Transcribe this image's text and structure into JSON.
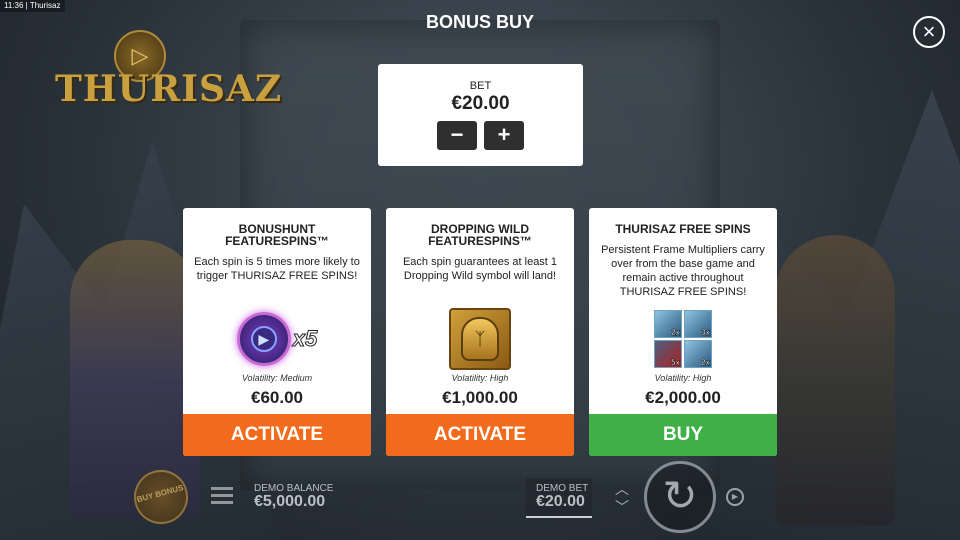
{
  "status_bar": {
    "time": "11:36",
    "app": "Thurisaz"
  },
  "logo": {
    "text": "THURISAZ"
  },
  "header": {
    "title": "BONUS BUY"
  },
  "bet": {
    "label": "BET",
    "value": "€20.00",
    "minus": "−",
    "plus": "+"
  },
  "cards": [
    {
      "title": "BONUSHUNT FEATURESPINS™",
      "description": "Each spin is 5 times more likely to trigger THURISAZ FREE SPINS!",
      "multiplier": "x5",
      "volatility": "Volatility: Medium",
      "price": "€60.00",
      "action": "ACTIVATE",
      "action_color": "#f26a1b"
    },
    {
      "title": "DROPPING WILD FEATURESPINS™",
      "description": "Each spin guarantees at least 1 Dropping Wild symbol will land!",
      "volatility": "Volatility: High",
      "price": "€1,000.00",
      "action": "ACTIVATE",
      "action_color": "#f26a1b"
    },
    {
      "title": "THURISAZ FREE SPINS",
      "description": "Persistent Frame Multipliers carry over from the base game and remain active throughout THURISAZ FREE SPINS!",
      "multipliers": [
        "2x",
        "3x",
        "5x",
        "2x"
      ],
      "volatility": "Volatility: High",
      "price": "€2,000.00",
      "action": "BUY",
      "action_color": "#3fb045"
    }
  ],
  "hud": {
    "buy_bonus": "BUY BONUS",
    "balance_label": "DEMO BALANCE",
    "balance_value": "€5,000.00",
    "bet_label": "DEMO BET",
    "bet_value": "€20.00"
  },
  "icons": {
    "close": "close-icon",
    "menu": "menu-icon",
    "spin": "spin-icon",
    "autoplay": "autoplay-icon",
    "bet_arrows": "chevron-up-down-icon"
  }
}
